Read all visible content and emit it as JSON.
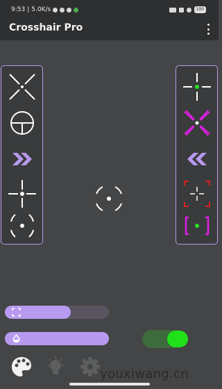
{
  "status_bar": {
    "time": "9:53",
    "speed": "5.0K/s",
    "battery": "100"
  },
  "app_bar": {
    "title": "Crosshair Pro",
    "menu_icon": "more-vert-icon"
  },
  "left_crosshairs": [
    "x-diagonal",
    "scope-circle",
    "double-chevron-right",
    "plus-dot",
    "broken-circle-dot"
  ],
  "right_crosshairs": [
    "plus-green-dot",
    "magenta-x-dot",
    "double-chevron-left",
    "red-brackets-plus",
    "magenta-brackets-green-dot"
  ],
  "center_crosshair": "broken-circle-dot",
  "sliders": [
    {
      "icon": "resize-icon",
      "value": 0.63
    },
    {
      "icon": "opacity-icon",
      "value": 1.0
    }
  ],
  "toggle": {
    "on": true
  },
  "bottom_nav": [
    "palette-icon",
    "lightbulb-icon",
    "settings-icon"
  ],
  "watermark": "youxiwang.cn",
  "colors": {
    "accent": "#b79af0",
    "toggle_on": "#20e01a",
    "green_dot": "#29e026",
    "magenta": "#e21fe8",
    "red": "#e02020"
  }
}
